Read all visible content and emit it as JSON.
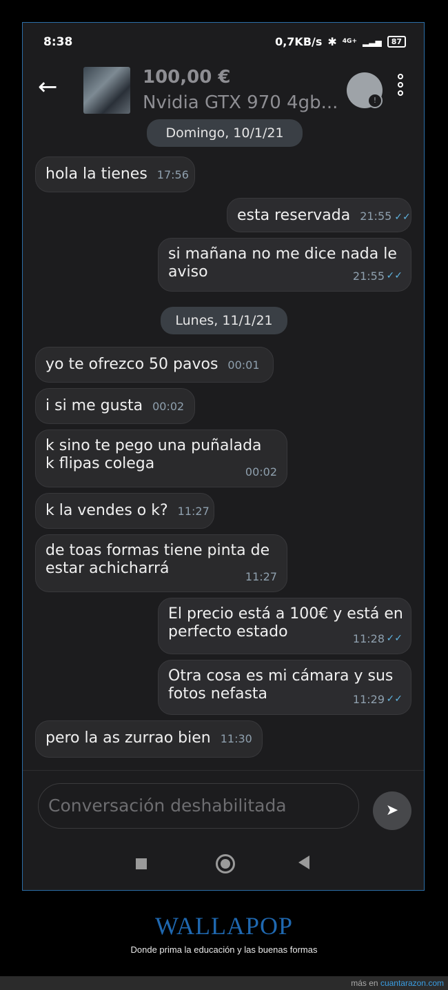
{
  "status": {
    "time": "8:38",
    "speed": "0,7KB/s",
    "network": "4G+",
    "battery": "87"
  },
  "header": {
    "price": "100,00 €",
    "title": "Nvidia GTX 970 4gb..."
  },
  "dates": [
    "Domingo, 10/1/21",
    "Lunes, 11/1/21"
  ],
  "messages": [
    {
      "dir": "in",
      "text": "hola la tienes",
      "time": "17:56"
    },
    {
      "dir": "out",
      "text": "esta reservada",
      "time": "21:55"
    },
    {
      "dir": "out",
      "text": "si mañana no me dice nada le\naviso",
      "time": "21:55"
    },
    {
      "dir": "in",
      "text": "yo te ofrezco 50 pavos",
      "time": "00:01"
    },
    {
      "dir": "in",
      "text": "i si me gusta",
      "time": "00:02"
    },
    {
      "dir": "in",
      "text": "k sino te pego una puñalada\nk flipas colega",
      "time": "00:02"
    },
    {
      "dir": "in",
      "text": "k la vendes o k?",
      "time": "11:27"
    },
    {
      "dir": "in",
      "text": "de toas formas tiene pinta de\nestar achicharrá",
      "time": "11:27"
    },
    {
      "dir": "out",
      "text": "El precio está a 100€ y está en\nperfecto estado",
      "time": "11:28"
    },
    {
      "dir": "out",
      "text": "Otra cosa es mi cámara y sus\nfotos nefasta",
      "time": "11:29"
    },
    {
      "dir": "in",
      "text": "pero la as zurrao bien",
      "time": "11:30"
    }
  ],
  "input": {
    "placeholder": "Conversación deshabilitada"
  },
  "caption": {
    "title": "WALLAPOP",
    "subtitle": "Donde prima la educación y las buenas formas"
  },
  "footer": {
    "prefix": "más en",
    "site": "cuantarazon.com"
  },
  "colors": {
    "bubble": "#2a2a2c",
    "ticks": "#5fb4e0",
    "accent": "#1f68b0"
  }
}
